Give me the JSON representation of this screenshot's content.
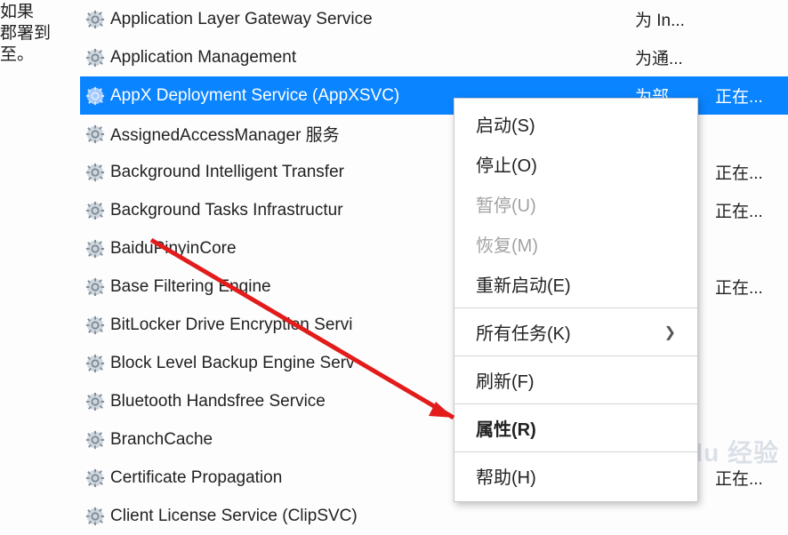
{
  "left_fragment_lines": [
    "如果",
    "郡署到",
    "至。"
  ],
  "services": [
    {
      "name": "Application Layer Gateway Service",
      "desc": "为 In...",
      "status": ""
    },
    {
      "name": "Application Management",
      "desc": "为通...",
      "status": ""
    },
    {
      "name": "AppX Deployment Service (AppXSVC)",
      "desc": "为部",
      "status": "正在...",
      "selected": true
    },
    {
      "name": "AssignedAccessManager 服务",
      "desc": "",
      "status": ""
    },
    {
      "name": "Background Intelligent Transfer",
      "desc": "",
      "status": "正在..."
    },
    {
      "name": "Background Tasks Infrastructur",
      "desc": "",
      "status": "正在..."
    },
    {
      "name": "BaiduPinyinCore",
      "desc": "",
      "status": ""
    },
    {
      "name": "Base Filtering Engine",
      "desc": "",
      "status": "正在..."
    },
    {
      "name": "BitLocker Drive Encryption Servi",
      "desc": "",
      "status": ""
    },
    {
      "name": "Block Level Backup Engine Serv",
      "desc": "",
      "status": ""
    },
    {
      "name": "Bluetooth Handsfree Service",
      "desc": "",
      "status": ""
    },
    {
      "name": "BranchCache",
      "desc": "",
      "status": ""
    },
    {
      "name": "Certificate Propagation",
      "desc": "",
      "status": "正在..."
    },
    {
      "name": "Client License Service (ClipSVC)",
      "desc": "",
      "status": ""
    }
  ],
  "context_menu": {
    "items": [
      {
        "label": "启动(S)",
        "enabled": true
      },
      {
        "label": "停止(O)",
        "enabled": true
      },
      {
        "label": "暂停(U)",
        "enabled": false
      },
      {
        "label": "恢复(M)",
        "enabled": false
      },
      {
        "label": "重新启动(E)",
        "enabled": true
      },
      {
        "sep": true
      },
      {
        "label": "所有任务(K)",
        "enabled": true,
        "submenu": true
      },
      {
        "sep": true
      },
      {
        "label": "刷新(F)",
        "enabled": true
      },
      {
        "sep": true
      },
      {
        "label": "属性(R)",
        "enabled": true,
        "bold": true
      },
      {
        "sep": true
      },
      {
        "label": "帮助(H)",
        "enabled": true
      }
    ]
  },
  "watermark": "Baidu 经验"
}
